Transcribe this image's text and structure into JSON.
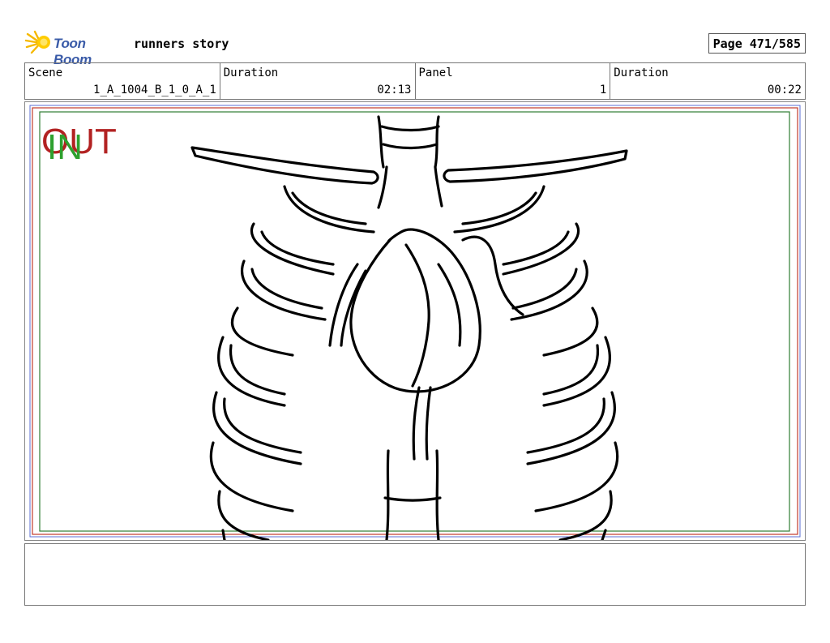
{
  "header": {
    "logo_text": "Toon Boom",
    "project_title": "runners story",
    "page_label": "Page 471/585"
  },
  "info": {
    "scene_label": "Scene",
    "scene_value": "1_A_1004_B_1_0_A_1",
    "scene_duration_label": "Duration",
    "scene_duration_value": "02:13",
    "panel_label": "Panel",
    "panel_value": "1",
    "panel_duration_label": "Duration",
    "panel_duration_value": "00:22"
  },
  "panel": {
    "out_marker": "OUT",
    "in_marker": "IN",
    "colors": {
      "out": "#b22222",
      "in": "#2ea02e",
      "safe_red": "#c0392b",
      "safe_blue": "#5b6fd6",
      "safe_green": "#2e7d32"
    }
  },
  "notes": {
    "text": ""
  }
}
